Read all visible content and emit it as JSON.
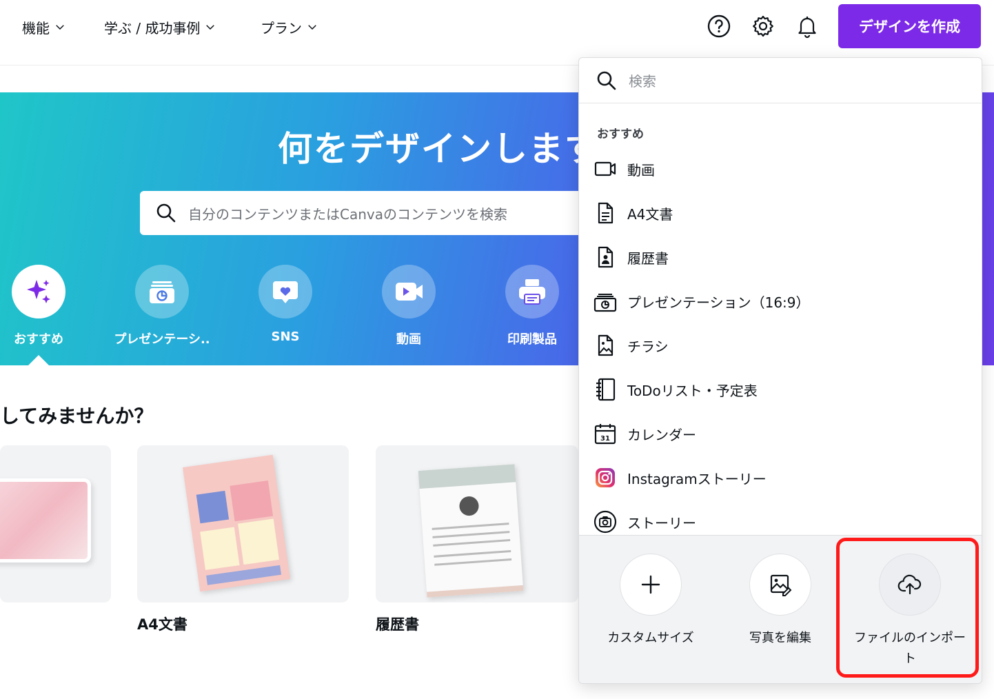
{
  "nav": {
    "items": [
      {
        "label": "機能"
      },
      {
        "label": "学ぶ / 成功事例"
      },
      {
        "label": "プラン"
      }
    ],
    "create_button": "デザインを作成",
    "icons": [
      "help-icon",
      "settings-gear-icon",
      "notification-bell-icon"
    ]
  },
  "hero": {
    "title": "何をデザインしますか？",
    "search_placeholder": "自分のコンテンツまたはCanvaのコンテンツを検索",
    "categories": [
      {
        "label": "おすすめ",
        "icon": "sparkle-icon"
      },
      {
        "label": "プレゼンテーシ..",
        "icon": "presentation-icon"
      },
      {
        "label": "SNS",
        "icon": "heart-chat-icon"
      },
      {
        "label": "動画",
        "icon": "video-camera-icon"
      },
      {
        "label": "印刷製品",
        "icon": "printer-icon"
      }
    ]
  },
  "suggestions": {
    "heading": "してみませんか？",
    "cards": [
      {
        "label": ""
      },
      {
        "label": "A4文書"
      },
      {
        "label": "履歴書"
      }
    ]
  },
  "dropdown": {
    "search_placeholder": "検索",
    "section_label": "おすすめ",
    "items": [
      {
        "label": "動画",
        "icon": "video-icon"
      },
      {
        "label": "A4文書",
        "icon": "document-icon"
      },
      {
        "label": "履歴書",
        "icon": "resume-icon"
      },
      {
        "label": "プレゼンテーション（16:9）",
        "icon": "presentation-icon"
      },
      {
        "label": "チラシ",
        "icon": "flyer-icon"
      },
      {
        "label": "ToDoリスト・予定表",
        "icon": "notebook-icon"
      },
      {
        "label": "カレンダー",
        "icon": "calendar-icon"
      },
      {
        "label": "Instagramストーリー",
        "icon": "instagram-icon"
      },
      {
        "label": "ストーリー",
        "icon": "camera-icon"
      }
    ],
    "actions": [
      {
        "label": "カスタムサイズ",
        "icon": "plus-icon"
      },
      {
        "label": "写真を編集",
        "icon": "image-edit-icon"
      },
      {
        "label": "ファイルのインポート",
        "icon": "cloud-upload-icon"
      }
    ],
    "calendar_day": "31"
  },
  "colors": {
    "accent": "#7d2ae8",
    "highlight": "#ff1a1a",
    "instagram": "#e1306c"
  }
}
